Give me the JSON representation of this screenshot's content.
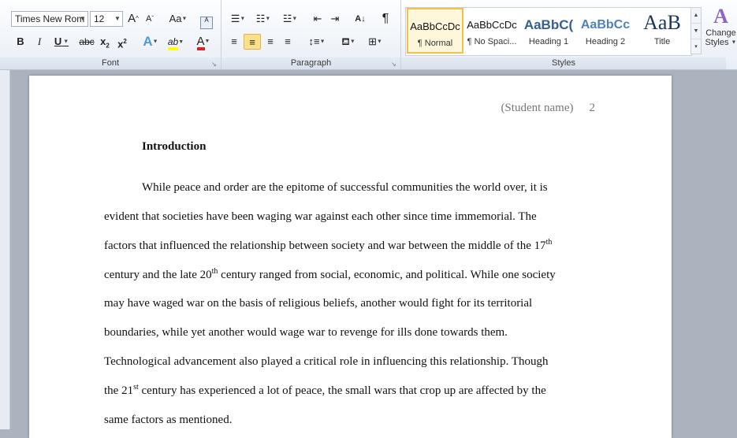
{
  "ribbon": {
    "font": {
      "label": "Font",
      "font_name": "Times New Rom",
      "font_size": "12",
      "grow": "A",
      "shrink": "A",
      "change_case": "Aa",
      "clear_format": "A",
      "bold": "B",
      "italic": "I",
      "underline": "U",
      "strikethrough": "abc",
      "subscript": "x",
      "superscript": "x",
      "subscript_mark": "2",
      "superscript_mark": "2",
      "text_effects": "A",
      "highlight": "ab",
      "font_color": "A"
    },
    "paragraph": {
      "label": "Paragraph",
      "sort": "A",
      "pilcrow": "¶"
    },
    "styles": {
      "label": "Styles",
      "tiles": [
        {
          "preview": "AaBbCcDc",
          "name": "¶ Normal"
        },
        {
          "preview": "AaBbCcDc",
          "name": "¶ No Spaci..."
        },
        {
          "preview": "AaBbC(",
          "name": "Heading 1"
        },
        {
          "preview": "AaBbCc",
          "name": "Heading 2"
        },
        {
          "preview": "AaB",
          "name": "Title"
        }
      ],
      "change_styles_label": "Change",
      "change_styles_label2": "Styles"
    }
  },
  "document": {
    "header_name": "(Student name)",
    "page_number": "2",
    "heading": "Introduction",
    "lines": [
      {
        "pre": "While peace and order are the epitome of successful communities the world over, it is",
        "sup": "",
        "post": ""
      },
      {
        "pre": "evident that societies have been waging war against each other since time immemorial.  The",
        "sup": "",
        "post": ""
      },
      {
        "pre": "factors that influenced the relationship between society and war between the middle of the 17",
        "sup": "th",
        "post": ""
      },
      {
        "pre": "century and the late 20",
        "sup": "th",
        "post": " century ranged from social, economic, and political.  While one society"
      },
      {
        "pre": "may have waged war on the basis of religious  beliefs, another would fight for its territorial",
        "sup": "",
        "post": ""
      },
      {
        "pre": "boundaries, while yet another would wage war to revenge for ills  done towards them.",
        "sup": "",
        "post": ""
      },
      {
        "pre": "Technological  advancement also played a critical role in influencing this relationship.  Though",
        "sup": "",
        "post": ""
      },
      {
        "pre": "the 21",
        "sup": "st",
        "post": " century has experienced a lot of peace, the small wars that crop up are affected by the"
      },
      {
        "pre": "same  factors as mentioned.",
        "sup": "",
        "post": ""
      }
    ]
  },
  "colors": {
    "highlight_yellow": "#ffff00",
    "font_color_red": "#e02020",
    "heading_blue": "#365f91",
    "selection_gold": "#f0c14b"
  }
}
